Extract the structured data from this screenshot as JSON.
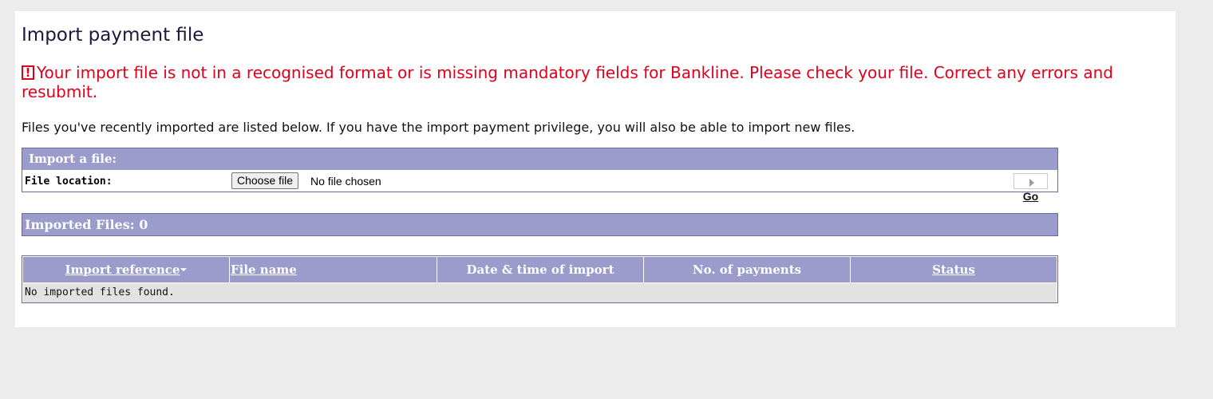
{
  "page": {
    "title": "Import payment file",
    "error_message": "Your import file is not in a recognised format or is missing mandatory fields for Bankline. Please check your file. Correct any errors and resubmit.",
    "error_icon": "exclamation-icon",
    "intro": "Files you've recently imported are listed below. If you have the import payment privilege, you will also be able to import new files."
  },
  "import_form": {
    "header": "Import a file:",
    "file_location_label": "File location:",
    "choose_button": "Choose file",
    "no_file_text": "No file chosen",
    "go_button": "Go"
  },
  "imported_files": {
    "header": "Imported Files: 0",
    "columns": [
      "Import reference",
      "File name",
      "Date & time of import",
      "No. of payments",
      "Status"
    ],
    "empty_text": "No imported files found."
  },
  "colors": {
    "header_bg": "#9b9bcc",
    "error": "#e0001b",
    "page_bg": "#ececec"
  }
}
